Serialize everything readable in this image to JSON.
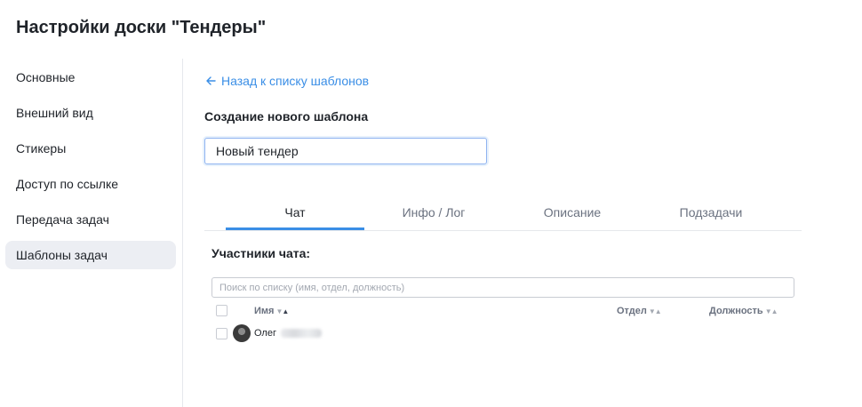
{
  "page": {
    "title": "Настройки доски \"Тендеры\""
  },
  "sidebar": {
    "items": [
      {
        "label": "Основные",
        "active": false
      },
      {
        "label": "Внешний вид",
        "active": false
      },
      {
        "label": "Стикеры",
        "active": false
      },
      {
        "label": "Доступ по ссылке",
        "active": false
      },
      {
        "label": "Передача задач",
        "active": false
      },
      {
        "label": "Шаблоны задач",
        "active": true
      }
    ]
  },
  "main": {
    "back_link": "Назад к списку шаблонов",
    "section_title": "Создание нового шаблона",
    "template_name": {
      "value": "Новый тендер"
    },
    "tabs": [
      {
        "label": "Чат",
        "active": true
      },
      {
        "label": "Инфо / Лог",
        "active": false
      },
      {
        "label": "Описание",
        "active": false
      },
      {
        "label": "Подзадачи",
        "active": false
      }
    ],
    "members": {
      "title": "Участники чата:",
      "search_placeholder": "Поиск по списку (имя, отдел, должность)",
      "columns": {
        "name": "Имя",
        "department": "Отдел",
        "position": "Должность"
      },
      "rows": [
        {
          "name": "Олег"
        }
      ]
    }
  },
  "colors": {
    "accent": "#3a8ee6",
    "active_sidebar_bg": "#eceef3"
  },
  "icons": {
    "back": "arrow-left-icon",
    "sort": "sort-arrows-icon"
  }
}
